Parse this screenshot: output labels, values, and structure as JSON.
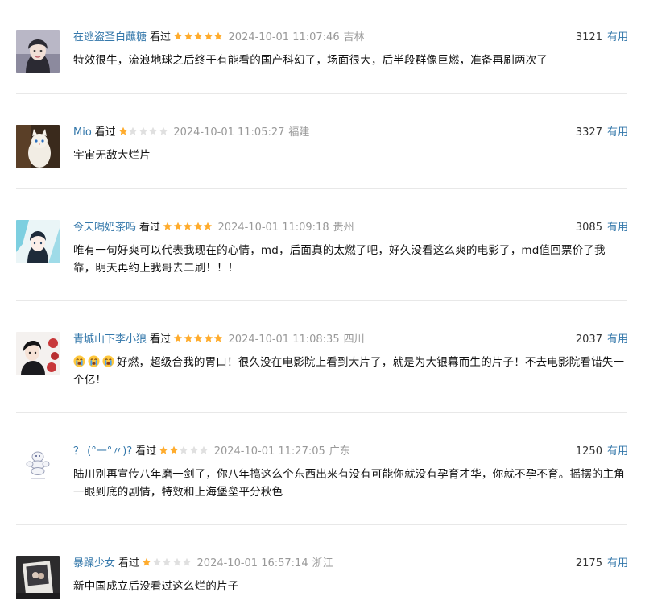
{
  "colors": {
    "username": "#3377aa",
    "star_on": "#ffac2d",
    "star_off": "#e0e0e0",
    "muted": "#999999",
    "divider": "#e8e8e8"
  },
  "seen_label": "看过",
  "useful_label": "有用",
  "comments": [
    {
      "user": "在逃盗圣白蘸糖",
      "rating": 5,
      "time": "2024-10-01 11:07:46",
      "location": "吉林",
      "votes": "3121",
      "text": "特效很牛，流浪地球之后终于有能看的国产科幻了，场面很大，后半段群像巨燃，准备再刷两次了",
      "avatar_icon": "portrait-woman-avatar"
    },
    {
      "user": "Mio",
      "rating": 1,
      "time": "2024-10-01 11:05:27",
      "location": "福建",
      "votes": "3327",
      "text": "宇宙无敌大烂片",
      "avatar_icon": "white-cat-avatar"
    },
    {
      "user": "今天喝奶茶吗",
      "rating": 5,
      "time": "2024-10-01 11:09:18",
      "location": "贵州",
      "votes": "3085",
      "text": "唯有一句好爽可以代表我现在的心情，md，后面真的太燃了吧，好久没看这么爽的电影了，md值回票价了我靠，明天再约上我哥去二刷！！！",
      "avatar_icon": "anime-girl-avatar"
    },
    {
      "user": "青城山下李小狼",
      "rating": 5,
      "time": "2024-10-01 11:08:35",
      "location": "四川",
      "votes": "2037",
      "text": "好燃，超级合我的胃口！很久没在电影院上看到大片了，就是为大银幕而生的片子！不去电影院看错失一个亿！",
      "emoji_count": 3,
      "emoji_icon": "crying-face-icon",
      "avatar_icon": "anime-boy-avatar"
    },
    {
      "user": "？ (°一°〃)?",
      "rating": 2,
      "time": "2024-10-01 11:27:05",
      "location": "广东",
      "votes": "1250",
      "text": "陆川别再宣传八年磨一剑了，你八年搞这么个东西出来有没有可能你就没有孕育才华，你就不孕不育。摇摆的主角一眼到底的剧情，特效和上海堡垒平分秋色",
      "avatar_icon": "michelin-man-avatar"
    },
    {
      "user": "暴躁少女",
      "rating": 1,
      "time": "2024-10-01 16:57:14",
      "location": "浙江",
      "votes": "2175",
      "text": "新中国成立后没看过这么烂的片子",
      "avatar_icon": "polaroid-photo-avatar"
    }
  ]
}
